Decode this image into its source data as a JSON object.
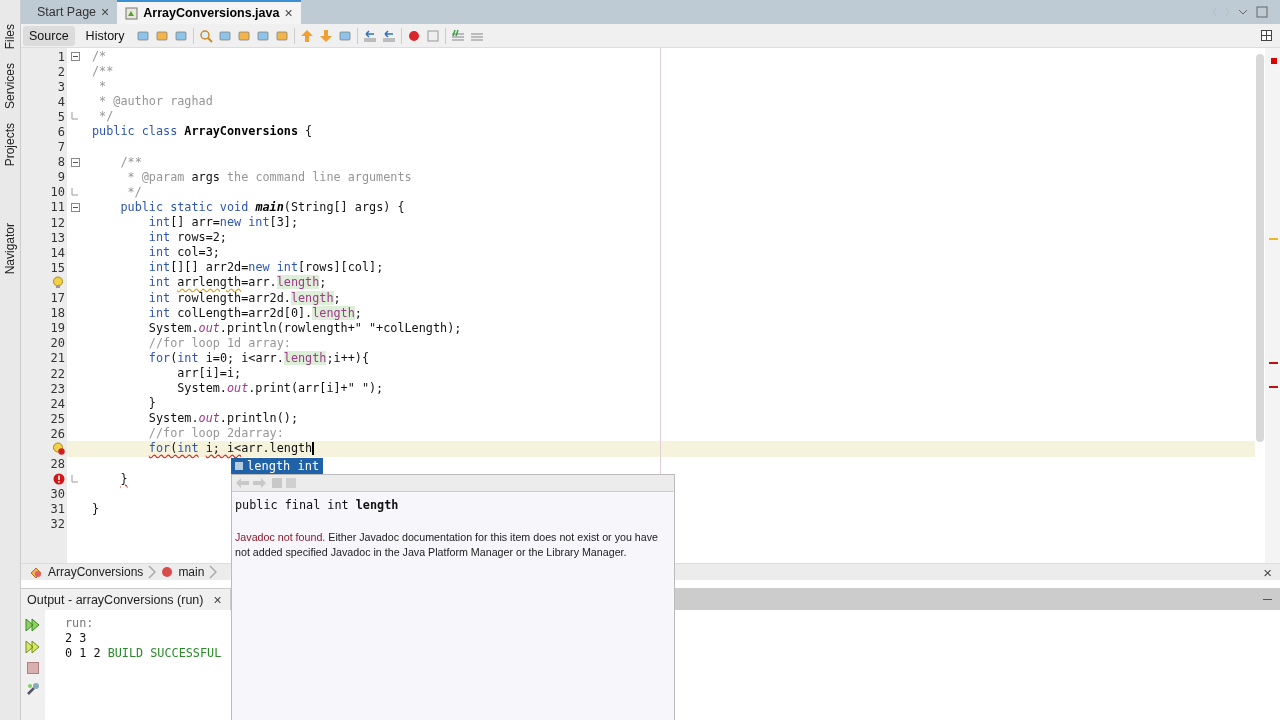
{
  "sidebar": {
    "items": [
      {
        "label": "Files"
      },
      {
        "label": "Services"
      },
      {
        "label": "Projects"
      },
      {
        "label": "Navigator"
      }
    ]
  },
  "tabs": [
    {
      "label": "Start Page",
      "close": "×",
      "selected": false
    },
    {
      "label": "ArrayConversions.java",
      "close": "×",
      "selected": true
    }
  ],
  "view_buttons": [
    {
      "label": "Source",
      "selected": true
    },
    {
      "label": "History",
      "selected": false
    }
  ],
  "editor": {
    "lines": [
      {
        "num": "1",
        "fold_start": true,
        "tokens": [
          {
            "t": "/*",
            "kind": "comment"
          }
        ]
      },
      {
        "num": "2",
        "tokens": [
          {
            "t": "/**",
            "kind": "comment"
          }
        ]
      },
      {
        "num": "3",
        "tokens": [
          {
            "t": " *",
            "kind": "comment"
          }
        ]
      },
      {
        "num": "4",
        "tokens": [
          {
            "t": " * @author raghad",
            "kind": "comment"
          }
        ]
      },
      {
        "num": "5",
        "fold_end": true,
        "tokens": [
          {
            "t": " */",
            "kind": "comment"
          }
        ]
      },
      {
        "num": "6",
        "tokens": [
          {
            "t": "public class ",
            "kind": "keyword"
          },
          {
            "t": "ArrayConversions",
            "kind": "classname"
          },
          {
            "t": " {",
            "kind": "plain"
          }
        ]
      },
      {
        "num": "7"
      },
      {
        "num": "8",
        "fold_start": true,
        "tokens": [
          {
            "t": "    /**",
            "kind": "comment"
          }
        ]
      },
      {
        "num": "9",
        "tokens": [
          {
            "t": "     * @param ",
            "kind": "comment"
          },
          {
            "t": "args",
            "kind": "plain"
          },
          {
            "t": " the command line arguments",
            "kind": "comment"
          }
        ]
      },
      {
        "num": "10",
        "fold_end": true,
        "tokens": [
          {
            "t": "     */",
            "kind": "comment"
          }
        ]
      },
      {
        "num": "11",
        "fold_start": true,
        "tokens": [
          {
            "t": "    public static void ",
            "kind": "keyword"
          },
          {
            "t": "main",
            "kind": "method"
          },
          {
            "t": "(String[] args) {",
            "kind": "plain"
          }
        ]
      },
      {
        "num": "12",
        "tokens": [
          {
            "t": "        int",
            "kind": "keyword"
          },
          {
            "t": "[] arr=",
            "kind": "plain"
          },
          {
            "t": "new int",
            "kind": "keyword"
          },
          {
            "t": "[3];",
            "kind": "plain"
          }
        ]
      },
      {
        "num": "13",
        "tokens": [
          {
            "t": "        int",
            "kind": "keyword"
          },
          {
            "t": " rows=2;",
            "kind": "plain"
          }
        ]
      },
      {
        "num": "14",
        "tokens": [
          {
            "t": "        int",
            "kind": "keyword"
          },
          {
            "t": " col=3;",
            "kind": "plain"
          }
        ]
      },
      {
        "num": "15",
        "tokens": [
          {
            "t": "        int",
            "kind": "keyword"
          },
          {
            "t": "[][] arr2d=",
            "kind": "plain"
          },
          {
            "t": "new int",
            "kind": "keyword"
          },
          {
            "t": "[rows][col];",
            "kind": "plain"
          }
        ]
      },
      {
        "warning": true,
        "tokens": [
          {
            "t": "        int",
            "kind": "keyword"
          },
          {
            "t": " arrlength",
            "kind": "plain",
            "warning": true
          },
          {
            "t": "=arr.",
            "kind": "plain"
          },
          {
            "t": "length",
            "kind": "field"
          },
          {
            "t": ";",
            "kind": "plain"
          }
        ]
      },
      {
        "num": "17",
        "tokens": [
          {
            "t": "        int",
            "kind": "keyword"
          },
          {
            "t": " rowlength=arr2d.",
            "kind": "plain"
          },
          {
            "t": "length",
            "kind": "field"
          },
          {
            "t": ";",
            "kind": "plain"
          }
        ]
      },
      {
        "num": "18",
        "tokens": [
          {
            "t": "        int",
            "kind": "keyword"
          },
          {
            "t": " colLength=arr2d[0].",
            "kind": "plain"
          },
          {
            "t": "length",
            "kind": "field"
          },
          {
            "t": ";",
            "kind": "plain"
          }
        ]
      },
      {
        "num": "19",
        "tokens": [
          {
            "t": "        System.",
            "kind": "plain"
          },
          {
            "t": "out",
            "kind": "static"
          },
          {
            "t": ".println(rowlength+\" \"+colLength);",
            "kind": "plain"
          }
        ]
      },
      {
        "num": "20",
        "tokens": [
          {
            "t": "        //for loop 1d array:",
            "kind": "comment"
          }
        ]
      },
      {
        "num": "21",
        "tokens": [
          {
            "t": "        for",
            "kind": "keyword"
          },
          {
            "t": "(",
            "kind": "plain"
          },
          {
            "t": "int",
            "kind": "keyword"
          },
          {
            "t": " i=0; i<arr.",
            "kind": "plain"
          },
          {
            "t": "length",
            "kind": "field"
          },
          {
            "t": ";i++){",
            "kind": "plain"
          }
        ]
      },
      {
        "num": "22",
        "tokens": [
          {
            "t": "            arr[i]=i;",
            "kind": "plain"
          }
        ]
      },
      {
        "num": "23",
        "tokens": [
          {
            "t": "            System.",
            "kind": "plain"
          },
          {
            "t": "out",
            "kind": "static"
          },
          {
            "t": ".print(arr[i]+\" \");",
            "kind": "plain"
          }
        ]
      },
      {
        "num": "24",
        "tokens": [
          {
            "t": "        }",
            "kind": "plain"
          }
        ]
      },
      {
        "num": "25",
        "tokens": [
          {
            "t": "        System.",
            "kind": "plain"
          },
          {
            "t": "out",
            "kind": "static"
          },
          {
            "t": ".println();",
            "kind": "plain"
          }
        ]
      },
      {
        "num": "26",
        "tokens": [
          {
            "t": "        //for loop 2darray:",
            "kind": "comment"
          }
        ]
      },
      {
        "warning": true,
        "error": true,
        "current": true,
        "caret": true,
        "tokens": [
          {
            "t": "        for",
            "kind": "keyword",
            "error": true
          },
          {
            "t": "(",
            "kind": "plain",
            "error": true
          },
          {
            "t": "int",
            "kind": "keyword",
            "error": true
          },
          {
            "t": " i; i<",
            "kind": "plain",
            "error": true
          },
          {
            "t": "arr.length",
            "kind": "plain"
          }
        ]
      },
      {
        "num": "28"
      },
      {
        "error": true,
        "fold_end": true,
        "tokens": [
          {
            "t": "    }",
            "kind": "plain",
            "error": true
          }
        ]
      },
      {
        "num": "30"
      },
      {
        "num": "31",
        "tokens": [
          {
            "t": "}",
            "kind": "plain"
          }
        ]
      },
      {
        "num": "32"
      }
    ]
  },
  "breadcrumb": [
    {
      "label": "ArrayConversions",
      "kind": "class"
    },
    {
      "label": "main",
      "kind": "method"
    }
  ],
  "breadcrumb_close": "×",
  "completion": {
    "items": [
      {
        "name": "length",
        "type": "int",
        "selected": true
      }
    ],
    "doc": {
      "signature": "public final int **length**",
      "lead": "Javadoc not found.",
      "body": " Either Javadoc documentation for this item does not exist or you have not added specified Javadoc in the Java Platform Manager or the Library Manager."
    }
  },
  "output": {
    "title": "Output - arrayConversions (run)",
    "close": "×",
    "lines": [
      [
        {
          "t": "run:",
          "kind": "info"
        }
      ],
      [
        {
          "t": "2 3",
          "kind": "out"
        }
      ],
      [
        {
          "t": "0 1 2 ",
          "kind": "out"
        },
        {
          "t": "BUILD SUCCESSFUL",
          "kind": "success"
        }
      ]
    ]
  }
}
